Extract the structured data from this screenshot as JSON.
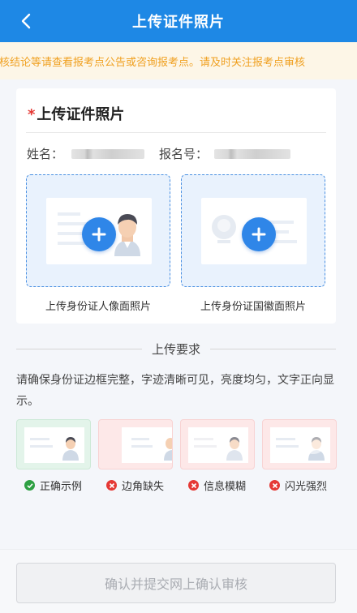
{
  "header": {
    "title": "上传证件照片",
    "back_icon": "chevron-left-icon"
  },
  "notice": {
    "text": "审核结论等请查看报考点公告或咨询报考点。请及时关注报考点审核"
  },
  "upload_card": {
    "required_mark": "*",
    "title": "上传证件照片",
    "name_label": "姓名：",
    "exam_no_label": "报名号：",
    "portrait": {
      "label": "上传身份证人像面照片",
      "icon": "plus-icon"
    },
    "emblem": {
      "label": "上传身份证国徽面照片",
      "icon": "plus-icon"
    }
  },
  "requirements": {
    "title": "上传要求",
    "text": "请确保身份证边框完整，字迹清晰可见，亮度均匀，文字正向显示。",
    "examples": [
      {
        "label": "正确示例",
        "status": "correct",
        "icon": "check-icon"
      },
      {
        "label": "边角缺失",
        "status": "wrong",
        "icon": "cross-icon"
      },
      {
        "label": "信息模糊",
        "status": "wrong",
        "icon": "cross-icon"
      },
      {
        "label": "闪光强烈",
        "status": "wrong",
        "icon": "cross-icon"
      }
    ]
  },
  "footer": {
    "submit_label": "确认并提交网上确认审核"
  },
  "colors": {
    "primary": "#1e88e5",
    "notice_text": "#f0a020",
    "correct": "#2ea043",
    "wrong": "#e53935"
  }
}
